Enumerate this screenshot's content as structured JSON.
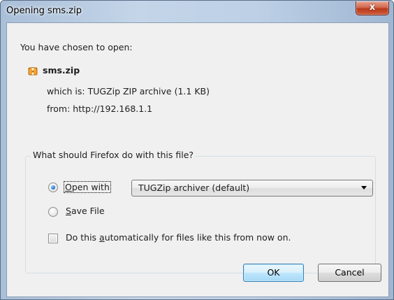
{
  "window": {
    "title": "Opening sms.zip",
    "close_glyph": "x"
  },
  "intro": "You have chosen to open:",
  "file": {
    "name": "sms.zip",
    "icon": "zip-archive-icon",
    "type_prefix": "which is: ",
    "type_value": "TUGZip ZIP archive (1.1 KB)",
    "from_prefix": "from: ",
    "from_value": "http://192.168.1.1"
  },
  "action_group": {
    "caption": "What should Firefox do with this file?",
    "open_with": {
      "label": "Open with",
      "mnemonic": "O",
      "label_rest": "pen with",
      "selected": true
    },
    "app_select": {
      "value": "TUGZip archiver (default)"
    },
    "save_file": {
      "label": "Save File",
      "mnemonic": "S",
      "label_rest": "ave File",
      "selected": false
    },
    "auto_checkbox": {
      "label": "Do this automatically for files like this from now on.",
      "label_before": "Do this ",
      "mnemonic": "a",
      "label_after": "utomatically for files like this from now on.",
      "checked": false
    }
  },
  "buttons": {
    "ok": "OK",
    "cancel": "Cancel"
  },
  "colors": {
    "titlebar": "#bdd0e6",
    "client": "#f0f0f0",
    "close": "#c8472a",
    "radio_dot": "#2a7dd6",
    "default_button": "#bee6fd"
  }
}
